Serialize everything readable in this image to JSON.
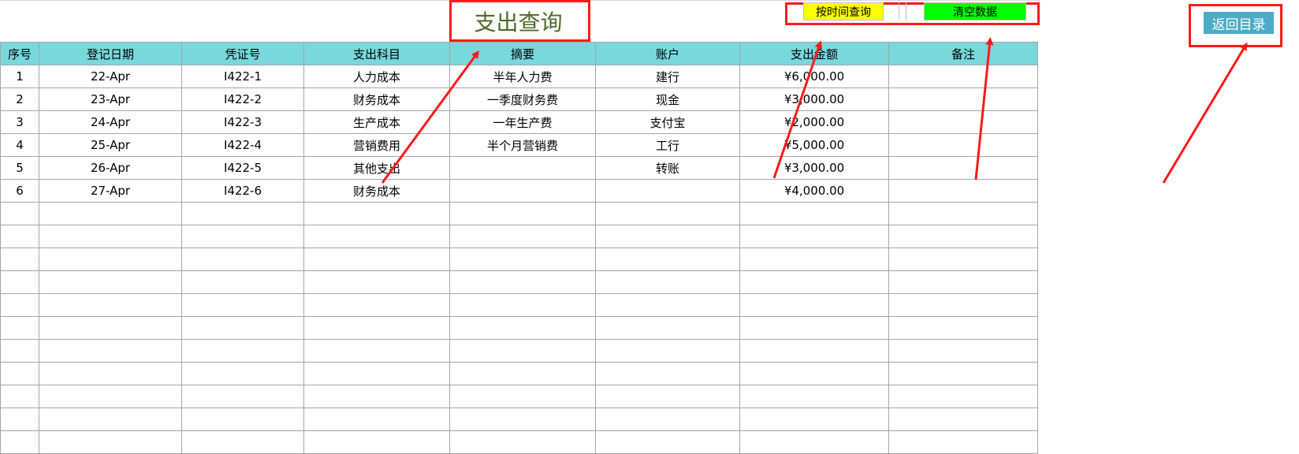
{
  "title": "支出查询",
  "buttons": {
    "query_by_time": "按时间查询",
    "clear_data": "清空数据",
    "back_to_menu": "返回目录"
  },
  "table": {
    "headers": [
      "序号",
      "登记日期",
      "凭证号",
      "支出科目",
      "摘要",
      "账户",
      "支出金额",
      "备注"
    ],
    "rows": [
      [
        "1",
        "22-Apr",
        "I422-1",
        "人力成本",
        "半年人力费",
        "建行",
        "¥6,000.00",
        ""
      ],
      [
        "2",
        "23-Apr",
        "I422-2",
        "财务成本",
        "一季度财务费",
        "现金",
        "¥3,000.00",
        ""
      ],
      [
        "3",
        "24-Apr",
        "I422-3",
        "生产成本",
        "一年生产费",
        "支付宝",
        "¥2,000.00",
        ""
      ],
      [
        "4",
        "25-Apr",
        "I422-4",
        "营销费用",
        "半个月营销费",
        "工行",
        "¥5,000.00",
        ""
      ],
      [
        "5",
        "26-Apr",
        "I422-5",
        "其他支出",
        "",
        "转账",
        "¥3,000.00",
        ""
      ],
      [
        "6",
        "27-Apr",
        "I422-6",
        "财务成本",
        "",
        "",
        "¥4,000.00",
        ""
      ]
    ],
    "empty_rows": 11
  },
  "colors": {
    "header_bg": "#78d8dc",
    "annotation_red": "#ff1a1a",
    "time_button_bg": "#ffff00",
    "clear_button_bg": "#00ff00",
    "back_button_bg": "#4bacc6",
    "title_color": "#4e6b2a"
  }
}
